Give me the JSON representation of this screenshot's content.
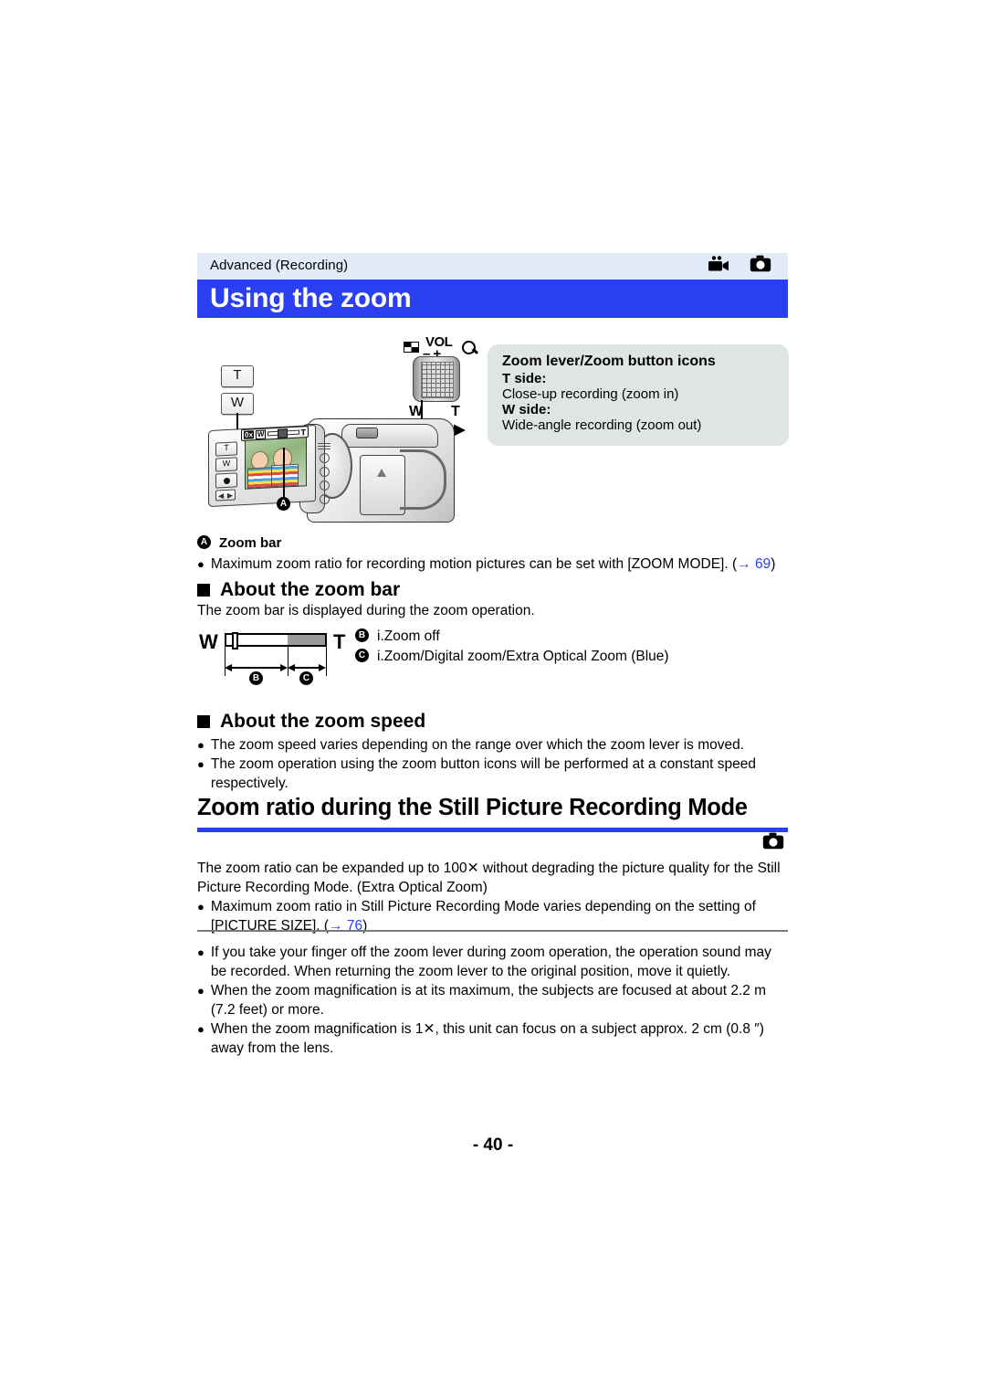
{
  "header": {
    "breadcrumb": "Advanced (Recording)",
    "icons": [
      "video-camera-icon",
      "still-camera-icon"
    ],
    "title": "Using the zoom",
    "title_bg": "#2a40f0",
    "strip_bg": "#e2ebf9"
  },
  "illustration": {
    "left_buttons": {
      "t": "T",
      "w": "W"
    },
    "lever": {
      "vol_label": "VOL",
      "minus": "–",
      "plus": "+",
      "w": "W",
      "t": "T",
      "thumbnail_icon": "multi-thumbnail-icon",
      "magnify_icon": "magnifier-icon"
    },
    "osd": {
      "ratio": "0x",
      "w": "W",
      "t": "T"
    },
    "lcd_buttons": {
      "t": "T",
      "w": "W"
    },
    "marker": "A"
  },
  "callout": {
    "title": "Zoom lever/Zoom button icons",
    "t_label": "T side:",
    "t_desc": "Close-up recording (zoom in)",
    "w_label": "W side:",
    "w_desc": "Wide-angle recording (zoom out)",
    "bg": "#dfe5e3"
  },
  "legend_a": {
    "marker": "A",
    "text": "Zoom bar"
  },
  "note_zoom_mode": {
    "text": "Maximum zoom ratio for recording motion pictures can be set with [ZOOM MODE]. (",
    "arrow": "→",
    "page": "69",
    "close": ")"
  },
  "section_zoom_bar": {
    "heading": "About the zoom bar",
    "body": "The zoom bar is displayed during the zoom operation.",
    "figure": {
      "w": "W",
      "t": "T",
      "marker_b": "B",
      "marker_c": "C"
    },
    "legend": [
      {
        "marker": "B",
        "text": "i.Zoom off"
      },
      {
        "marker": "C",
        "text": "i.Zoom/Digital zoom/Extra Optical Zoom (Blue)"
      }
    ]
  },
  "section_zoom_speed": {
    "heading": "About the zoom speed",
    "bullets": [
      "The zoom speed varies depending on the range over which the zoom lever is moved.",
      "The zoom operation using the zoom button icons will be performed at a constant speed respectively."
    ]
  },
  "section_still_mode": {
    "heading": "Zoom ratio during the Still Picture Recording Mode",
    "icon": "still-camera-icon",
    "intro_line1": "The zoom ratio can be expanded up to 100✕ without degrading the picture quality for the Still",
    "intro_line2": "Picture Recording Mode. (Extra Optical Zoom)",
    "bullet_line1": "Maximum zoom ratio in Still Picture Recording Mode varies depending on the setting of",
    "bullet_line2_pre": "[PICTURE SIZE]. (",
    "bullet_arrow": "→",
    "bullet_page": "76",
    "bullet_line2_post": ")"
  },
  "final_notes": [
    "If you take your finger off the zoom lever during zoom operation, the operation sound may be recorded. When returning the zoom lever to the original position, move it quietly.",
    "When the zoom magnification is at its maximum, the subjects are focused at about 2.2 m (7.2 feet) or more.",
    "When the zoom magnification is 1✕, this unit can focus on a subject approx. 2 cm (0.8 ″) away from the lens."
  ],
  "page_number": "- 40 -",
  "colors": {
    "accent_blue": "#2a40f0",
    "link_blue": "#2a40f0",
    "callout_gray": "#dfe5e3"
  }
}
